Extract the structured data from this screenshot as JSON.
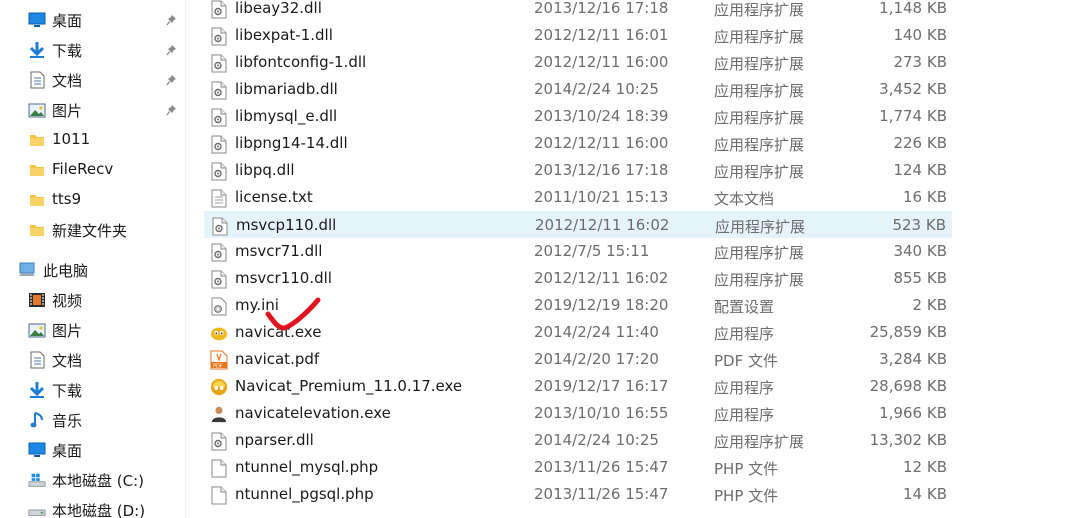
{
  "sidebar": {
    "quick_access": [
      {
        "label": "桌面",
        "icon": "desktop-icon",
        "pinned": true
      },
      {
        "label": "下载",
        "icon": "download-icon",
        "pinned": true
      },
      {
        "label": "文档",
        "icon": "documents-icon",
        "pinned": true
      },
      {
        "label": "图片",
        "icon": "pictures-icon",
        "pinned": true
      },
      {
        "label": "1011",
        "icon": "folder-icon",
        "pinned": false
      },
      {
        "label": "FileRecv",
        "icon": "folder-icon",
        "pinned": false
      },
      {
        "label": "tts9",
        "icon": "folder-icon",
        "pinned": false
      },
      {
        "label": "新建文件夹",
        "icon": "folder-icon",
        "pinned": false
      }
    ],
    "this_pc": {
      "label": "此电脑",
      "icon": "computer-icon"
    },
    "pc_items": [
      {
        "label": "视频",
        "icon": "videos-icon"
      },
      {
        "label": "图片",
        "icon": "pictures-icon"
      },
      {
        "label": "文档",
        "icon": "documents-icon"
      },
      {
        "label": "下载",
        "icon": "download-icon"
      },
      {
        "label": "音乐",
        "icon": "music-icon"
      },
      {
        "label": "桌面",
        "icon": "desktop-icon"
      },
      {
        "label": "本地磁盘 (C:)",
        "icon": "windows-drive-icon"
      },
      {
        "label": "本地磁盘 (D:)",
        "icon": "drive-icon"
      }
    ]
  },
  "files": [
    {
      "name": "libeay32.dll",
      "date": "2013/12/16 17:18",
      "type": "应用程序扩展",
      "size": "1,148 KB",
      "icon": "dll-icon"
    },
    {
      "name": "libexpat-1.dll",
      "date": "2012/12/11 16:01",
      "type": "应用程序扩展",
      "size": "140 KB",
      "icon": "dll-icon"
    },
    {
      "name": "libfontconfig-1.dll",
      "date": "2012/12/11 16:00",
      "type": "应用程序扩展",
      "size": "273 KB",
      "icon": "dll-icon"
    },
    {
      "name": "libmariadb.dll",
      "date": "2014/2/24 10:25",
      "type": "应用程序扩展",
      "size": "3,452 KB",
      "icon": "dll-icon"
    },
    {
      "name": "libmysql_e.dll",
      "date": "2013/10/24 18:39",
      "type": "应用程序扩展",
      "size": "1,774 KB",
      "icon": "dll-icon"
    },
    {
      "name": "libpng14-14.dll",
      "date": "2012/12/11 16:00",
      "type": "应用程序扩展",
      "size": "226 KB",
      "icon": "dll-icon"
    },
    {
      "name": "libpq.dll",
      "date": "2013/12/16 17:18",
      "type": "应用程序扩展",
      "size": "124 KB",
      "icon": "dll-icon"
    },
    {
      "name": "license.txt",
      "date": "2011/10/21 15:13",
      "type": "文本文档",
      "size": "16 KB",
      "icon": "text-file-icon"
    },
    {
      "name": "msvcp110.dll",
      "date": "2012/12/11 16:02",
      "type": "应用程序扩展",
      "size": "523 KB",
      "icon": "dll-icon",
      "selected": true
    },
    {
      "name": "msvcr71.dll",
      "date": "2012/7/5 15:11",
      "type": "应用程序扩展",
      "size": "340 KB",
      "icon": "dll-icon"
    },
    {
      "name": "msvcr110.dll",
      "date": "2012/12/11 16:02",
      "type": "应用程序扩展",
      "size": "855 KB",
      "icon": "dll-icon"
    },
    {
      "name": "my.ini",
      "date": "2019/12/19 18:20",
      "type": "配置设置",
      "size": "2 KB",
      "icon": "ini-settings-icon"
    },
    {
      "name": "navicat.exe",
      "date": "2014/2/24 11:40",
      "type": "应用程序",
      "size": "25,859 KB",
      "icon": "navicat-app-icon"
    },
    {
      "name": "navicat.pdf",
      "date": "2014/2/20 17:20",
      "type": "PDF 文件",
      "size": "3,284 KB",
      "icon": "pdf-icon"
    },
    {
      "name": "Navicat_Premium_11.0.17.exe",
      "date": "2019/12/17 16:17",
      "type": "应用程序",
      "size": "28,698 KB",
      "icon": "navicat-installer-icon"
    },
    {
      "name": "navicatelevation.exe",
      "date": "2013/10/10 16:55",
      "type": "应用程序",
      "size": "1,966 KB",
      "icon": "user-app-icon"
    },
    {
      "name": "nparser.dll",
      "date": "2014/2/24 10:25",
      "type": "应用程序扩展",
      "size": "13,302 KB",
      "icon": "dll-icon"
    },
    {
      "name": "ntunnel_mysql.php",
      "date": "2013/11/26 15:47",
      "type": "PHP 文件",
      "size": "12 KB",
      "icon": "blank-file-icon"
    },
    {
      "name": "ntunnel_pgsql.php",
      "date": "2013/11/26 15:47",
      "type": "PHP 文件",
      "size": "14 KB",
      "icon": "blank-file-icon"
    }
  ],
  "colors": {
    "selection": "#e5f3fb",
    "annotation": "#e0141e",
    "folder": "#f5c342",
    "link_blue": "#1e7bd6"
  }
}
